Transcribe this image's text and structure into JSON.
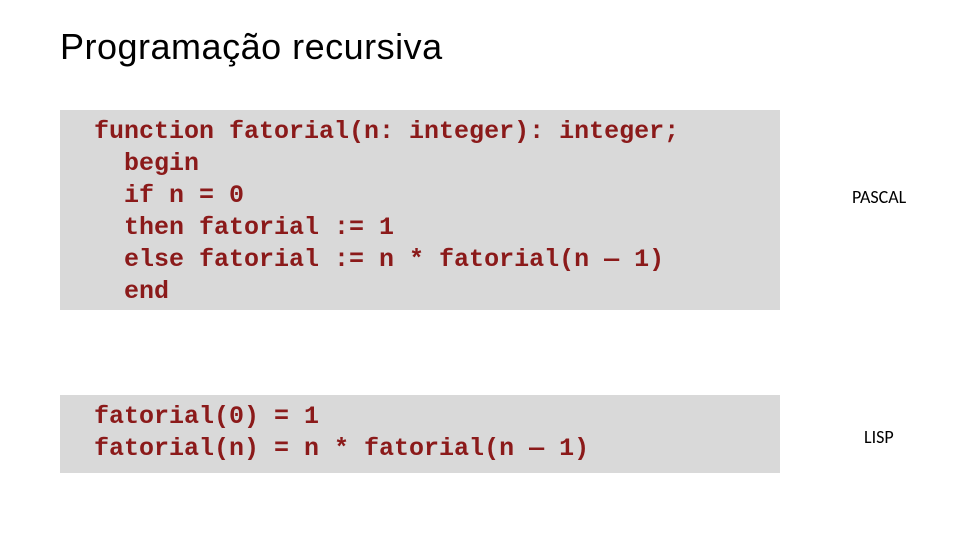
{
  "title": "Programação recursiva",
  "pascal": {
    "label": "PASCAL",
    "code": "function fatorial(n: integer): integer;\n  begin\n  if n = 0\n  then fatorial := 1\n  else fatorial := n * fatorial(n — 1)\n  end"
  },
  "lisp": {
    "label": "LISP",
    "code": "fatorial(0) = 1\nfatorial(n) = n * fatorial(n — 1)"
  }
}
